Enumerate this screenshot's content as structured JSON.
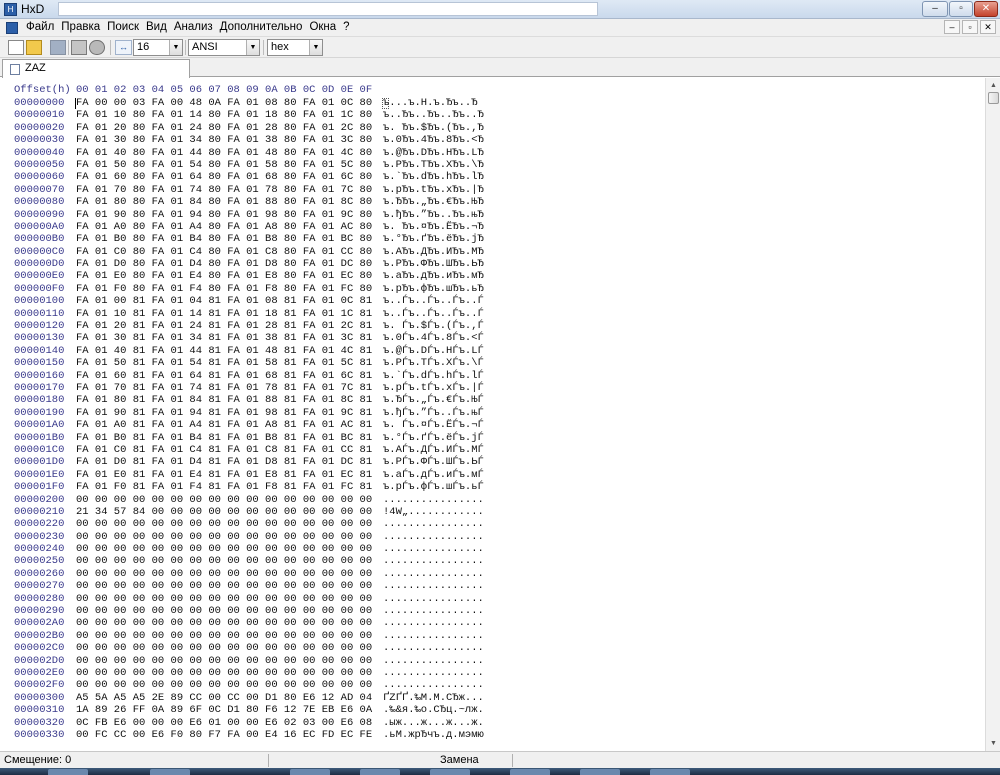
{
  "window": {
    "title": "HxD",
    "minimize": "–",
    "maximize": "▫",
    "close": "✕"
  },
  "menu": {
    "items": [
      "Файл",
      "Правка",
      "Поиск",
      "Вид",
      "Анализ",
      "Дополнительно",
      "Окна",
      "?"
    ],
    "mdi_minimize": "–",
    "mdi_restore": "▫",
    "mdi_close": "✕"
  },
  "toolbar": {
    "columns_icon": "↔",
    "bytes_per_row": "16",
    "charset": "ANSI",
    "offset_base": "hex",
    "dropdown_arrow": "▼"
  },
  "tab": {
    "label": "ZAZ"
  },
  "hex_view": {
    "offset_header": "Offset(h)",
    "column_header": "00 01 02 03 04 05 06 07 08 09 0A 0B 0C 0D 0E 0F",
    "rows": [
      {
        "off": "00000000",
        "hex": "FA 00 00 03 FA 00 48 0A FA 01 08 80 FA 01 0C 80",
        "txt": "ъ...ъ.H.ъ.Ђъ..Ђ"
      },
      {
        "off": "00000010",
        "hex": "FA 01 10 80 FA 01 14 80 FA 01 18 80 FA 01 1C 80",
        "txt": "ъ..Ђъ..Ђъ..Ђъ..Ђ"
      },
      {
        "off": "00000020",
        "hex": "FA 01 20 80 FA 01 24 80 FA 01 28 80 FA 01 2C 80",
        "txt": "ъ. Ђъ.$Ђъ.(Ђъ.,Ђ"
      },
      {
        "off": "00000030",
        "hex": "FA 01 30 80 FA 01 34 80 FA 01 38 80 FA 01 3C 80",
        "txt": "ъ.0Ђъ.4Ђъ.8Ђъ.<Ђ"
      },
      {
        "off": "00000040",
        "hex": "FA 01 40 80 FA 01 44 80 FA 01 48 80 FA 01 4C 80",
        "txt": "ъ.@Ђъ.DЂъ.HЂъ.LЂ"
      },
      {
        "off": "00000050",
        "hex": "FA 01 50 80 FA 01 54 80 FA 01 58 80 FA 01 5C 80",
        "txt": "ъ.PЂъ.TЂъ.XЂъ.\\Ђ"
      },
      {
        "off": "00000060",
        "hex": "FA 01 60 80 FA 01 64 80 FA 01 68 80 FA 01 6C 80",
        "txt": "ъ.`Ђъ.dЂъ.hЂъ.lЂ"
      },
      {
        "off": "00000070",
        "hex": "FA 01 70 80 FA 01 74 80 FA 01 78 80 FA 01 7C 80",
        "txt": "ъ.pЂъ.tЂъ.xЂъ.|Ђ"
      },
      {
        "off": "00000080",
        "hex": "FA 01 80 80 FA 01 84 80 FA 01 88 80 FA 01 8C 80",
        "txt": "ъ.ЂЂъ.„Ђъ.€Ђъ.ЊЂ"
      },
      {
        "off": "00000090",
        "hex": "FA 01 90 80 FA 01 94 80 FA 01 98 80 FA 01 9C 80",
        "txt": "ъ.ђЂъ.”Ђъ..Ђъ.њЂ"
      },
      {
        "off": "000000A0",
        "hex": "FA 01 A0 80 FA 01 A4 80 FA 01 A8 80 FA 01 AC 80",
        "txt": "ъ. Ђъ.¤Ђъ.ЁЂъ.¬Ђ"
      },
      {
        "off": "000000B0",
        "hex": "FA 01 B0 80 FA 01 B4 80 FA 01 B8 80 FA 01 BC 80",
        "txt": "ъ.°Ђъ.ґЂъ.ёЂъ.јЂ"
      },
      {
        "off": "000000C0",
        "hex": "FA 01 C0 80 FA 01 C4 80 FA 01 C8 80 FA 01 CC 80",
        "txt": "ъ.AЂъ.ДЂъ.ИЂъ.МЂ"
      },
      {
        "off": "000000D0",
        "hex": "FA 01 D0 80 FA 01 D4 80 FA 01 D8 80 FA 01 DC 80",
        "txt": "ъ.PЂъ.ФЂъ.ШЂъ.ЬЂ"
      },
      {
        "off": "000000E0",
        "hex": "FA 01 E0 80 FA 01 E4 80 FA 01 E8 80 FA 01 EC 80",
        "txt": "ъ.aЂъ.дЂъ.иЂъ.мЂ"
      },
      {
        "off": "000000F0",
        "hex": "FA 01 F0 80 FA 01 F4 80 FA 01 F8 80 FA 01 FC 80",
        "txt": "ъ.pЂъ.фЂъ.шЂъ.ьЂ"
      },
      {
        "off": "00000100",
        "hex": "FA 01 00 81 FA 01 04 81 FA 01 08 81 FA 01 0C 81",
        "txt": "ъ..Ѓъ..Ѓъ..Ѓъ..Ѓ"
      },
      {
        "off": "00000110",
        "hex": "FA 01 10 81 FA 01 14 81 FA 01 18 81 FA 01 1C 81",
        "txt": "ъ..Ѓъ..Ѓъ..Ѓъ..Ѓ"
      },
      {
        "off": "00000120",
        "hex": "FA 01 20 81 FA 01 24 81 FA 01 28 81 FA 01 2C 81",
        "txt": "ъ. Ѓъ.$Ѓъ.(Ѓъ.,Ѓ"
      },
      {
        "off": "00000130",
        "hex": "FA 01 30 81 FA 01 34 81 FA 01 38 81 FA 01 3C 81",
        "txt": "ъ.0Ѓъ.4Ѓъ.8Ѓъ.<Ѓ"
      },
      {
        "off": "00000140",
        "hex": "FA 01 40 81 FA 01 44 81 FA 01 48 81 FA 01 4C 81",
        "txt": "ъ.@Ѓъ.DЃъ.HЃъ.LЃ"
      },
      {
        "off": "00000150",
        "hex": "FA 01 50 81 FA 01 54 81 FA 01 58 81 FA 01 5C 81",
        "txt": "ъ.PЃъ.TЃъ.XЃъ.\\Ѓ"
      },
      {
        "off": "00000160",
        "hex": "FA 01 60 81 FA 01 64 81 FA 01 68 81 FA 01 6C 81",
        "txt": "ъ.`Ѓъ.dЃъ.hЃъ.lЃ"
      },
      {
        "off": "00000170",
        "hex": "FA 01 70 81 FA 01 74 81 FA 01 78 81 FA 01 7C 81",
        "txt": "ъ.pЃъ.tЃъ.xЃъ.|Ѓ"
      },
      {
        "off": "00000180",
        "hex": "FA 01 80 81 FA 01 84 81 FA 01 88 81 FA 01 8C 81",
        "txt": "ъ.ЂЃъ.„Ѓъ.€Ѓъ.ЊЃ"
      },
      {
        "off": "00000190",
        "hex": "FA 01 90 81 FA 01 94 81 FA 01 98 81 FA 01 9C 81",
        "txt": "ъ.ђЃъ.”Ѓъ..Ѓъ.њЃ"
      },
      {
        "off": "000001A0",
        "hex": "FA 01 A0 81 FA 01 A4 81 FA 01 A8 81 FA 01 AC 81",
        "txt": "ъ. Ѓъ.¤Ѓъ.ЁЃъ.¬Ѓ"
      },
      {
        "off": "000001B0",
        "hex": "FA 01 B0 81 FA 01 B4 81 FA 01 B8 81 FA 01 BC 81",
        "txt": "ъ.°Ѓъ.ґЃъ.ёЃъ.јЃ"
      },
      {
        "off": "000001C0",
        "hex": "FA 01 C0 81 FA 01 C4 81 FA 01 C8 81 FA 01 CC 81",
        "txt": "ъ.AЃъ.ДЃъ.ИЃъ.МЃ"
      },
      {
        "off": "000001D0",
        "hex": "FA 01 D0 81 FA 01 D4 81 FA 01 D8 81 FA 01 DC 81",
        "txt": "ъ.PЃъ.ФЃъ.ШЃъ.ЬЃ"
      },
      {
        "off": "000001E0",
        "hex": "FA 01 E0 81 FA 01 E4 81 FA 01 E8 81 FA 01 EC 81",
        "txt": "ъ.aЃъ.дЃъ.иЃъ.мЃ"
      },
      {
        "off": "000001F0",
        "hex": "FA 01 F0 81 FA 01 F4 81 FA 01 F8 81 FA 01 FC 81",
        "txt": "ъ.pЃъ.фЃъ.шЃъ.ьЃ"
      },
      {
        "off": "00000200",
        "hex": "00 00 00 00 00 00 00 00 00 00 00 00 00 00 00 00",
        "txt": "................"
      },
      {
        "off": "00000210",
        "hex": "21 34 57 84 00 00 00 00 00 00 00 00 00 00 00 00",
        "txt": "!4W„............"
      },
      {
        "off": "00000220",
        "hex": "00 00 00 00 00 00 00 00 00 00 00 00 00 00 00 00",
        "txt": "................"
      },
      {
        "off": "00000230",
        "hex": "00 00 00 00 00 00 00 00 00 00 00 00 00 00 00 00",
        "txt": "................"
      },
      {
        "off": "00000240",
        "hex": "00 00 00 00 00 00 00 00 00 00 00 00 00 00 00 00",
        "txt": "................"
      },
      {
        "off": "00000250",
        "hex": "00 00 00 00 00 00 00 00 00 00 00 00 00 00 00 00",
        "txt": "................"
      },
      {
        "off": "00000260",
        "hex": "00 00 00 00 00 00 00 00 00 00 00 00 00 00 00 00",
        "txt": "................"
      },
      {
        "off": "00000270",
        "hex": "00 00 00 00 00 00 00 00 00 00 00 00 00 00 00 00",
        "txt": "................"
      },
      {
        "off": "00000280",
        "hex": "00 00 00 00 00 00 00 00 00 00 00 00 00 00 00 00",
        "txt": "................"
      },
      {
        "off": "00000290",
        "hex": "00 00 00 00 00 00 00 00 00 00 00 00 00 00 00 00",
        "txt": "................"
      },
      {
        "off": "000002A0",
        "hex": "00 00 00 00 00 00 00 00 00 00 00 00 00 00 00 00",
        "txt": "................"
      },
      {
        "off": "000002B0",
        "hex": "00 00 00 00 00 00 00 00 00 00 00 00 00 00 00 00",
        "txt": "................"
      },
      {
        "off": "000002C0",
        "hex": "00 00 00 00 00 00 00 00 00 00 00 00 00 00 00 00",
        "txt": "................"
      },
      {
        "off": "000002D0",
        "hex": "00 00 00 00 00 00 00 00 00 00 00 00 00 00 00 00",
        "txt": "................"
      },
      {
        "off": "000002E0",
        "hex": "00 00 00 00 00 00 00 00 00 00 00 00 00 00 00 00",
        "txt": "................"
      },
      {
        "off": "000002F0",
        "hex": "00 00 00 00 00 00 00 00 00 00 00 00 00 00 00 00",
        "txt": "................"
      },
      {
        "off": "00000300",
        "hex": "A5 5A A5 A5 2E 89 CC 00 CC 00 D1 80 E6 12 AD 04",
        "txt": "ҐZҐҐ.‰M.M.CЂж..."
      },
      {
        "off": "00000310",
        "hex": "1A 89 26 FF 0A 89 6F 0C D1 80 F6 12 7E EB E6 0A",
        "txt": ".‰&я.‰o.СЂц.~лж."
      },
      {
        "off": "00000320",
        "hex": "0C FB E6 00 00 00 E6 01 00 00 E6 02 03 00 E6 08",
        "txt": ".ыж...ж...ж...ж."
      },
      {
        "off": "00000330",
        "hex": "00 FC CC 00 E6 F0 80 F7 FA 00 E4 16 EC FD EC FE",
        "txt": ".ьМ.жрЂчъ.д.мэмю"
      }
    ]
  },
  "scrollbar": {
    "up": "▲",
    "down": "▼"
  },
  "status": {
    "offset": "Смещение: 0",
    "mode": "Замена"
  }
}
